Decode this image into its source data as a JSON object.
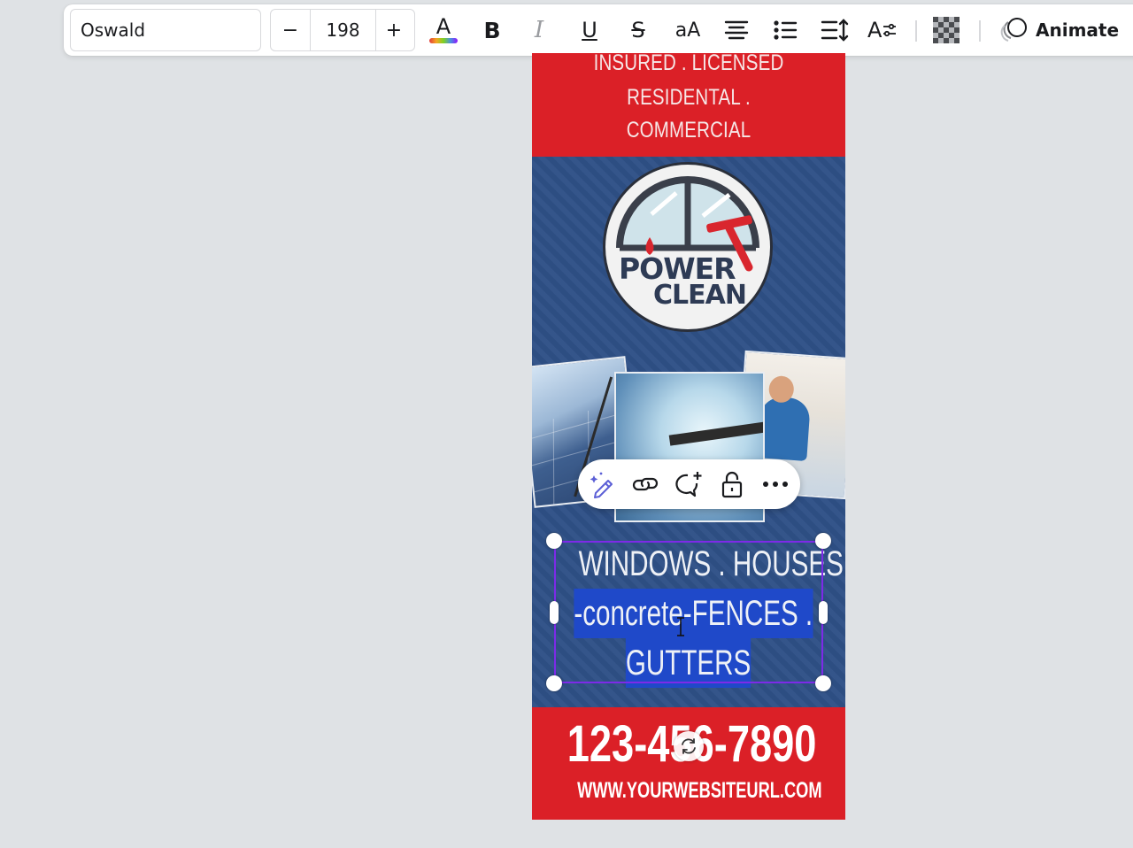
{
  "toolbar": {
    "font_name": "Oswald",
    "font_size": "198",
    "minus_label": "−",
    "plus_label": "+",
    "text_color_glyph": "A",
    "bold_glyph": "B",
    "italic_glyph": "I",
    "underline_glyph": "U",
    "strike_glyph": "S",
    "case_glyph": "aA",
    "spacing_glyph": "A",
    "animate_label": "Animate",
    "icons": [
      "text-color-icon",
      "bold-icon",
      "italic-icon",
      "underline-icon",
      "strikethrough-icon",
      "letter-case-icon",
      "align-center-icon",
      "bullet-list-icon",
      "line-spacing-icon",
      "text-effects-icon",
      "transparency-icon",
      "animate-icon"
    ],
    "colors": {
      "rainbow_underline": [
        "#e23b3b",
        "#f5a623",
        "#7ed321",
        "#4a90e2",
        "#9013fe"
      ]
    }
  },
  "design": {
    "top_lines": [
      "INSURED . LICENSED",
      "RESIDENTAL .",
      "COMMERCIAL"
    ],
    "logo_top": "POWER",
    "logo_bottom": "CLEAN",
    "headline_lines": [
      "WINDOWS . HOUSES",
      "-concrete-FENCES .",
      "GUTTERS"
    ],
    "phone": "123-456-7890",
    "website": "WWW.YOURWEBSITEURL.COM",
    "colors": {
      "red": "#db2027",
      "blue": "#2e5086",
      "selection": "#7d2ae8",
      "text_highlight": "#1f49c9"
    }
  },
  "floating_toolbar": {
    "icons": [
      "magic-edit-icon",
      "link-icon",
      "add-comment-icon",
      "lock-icon",
      "more-icon"
    ]
  }
}
